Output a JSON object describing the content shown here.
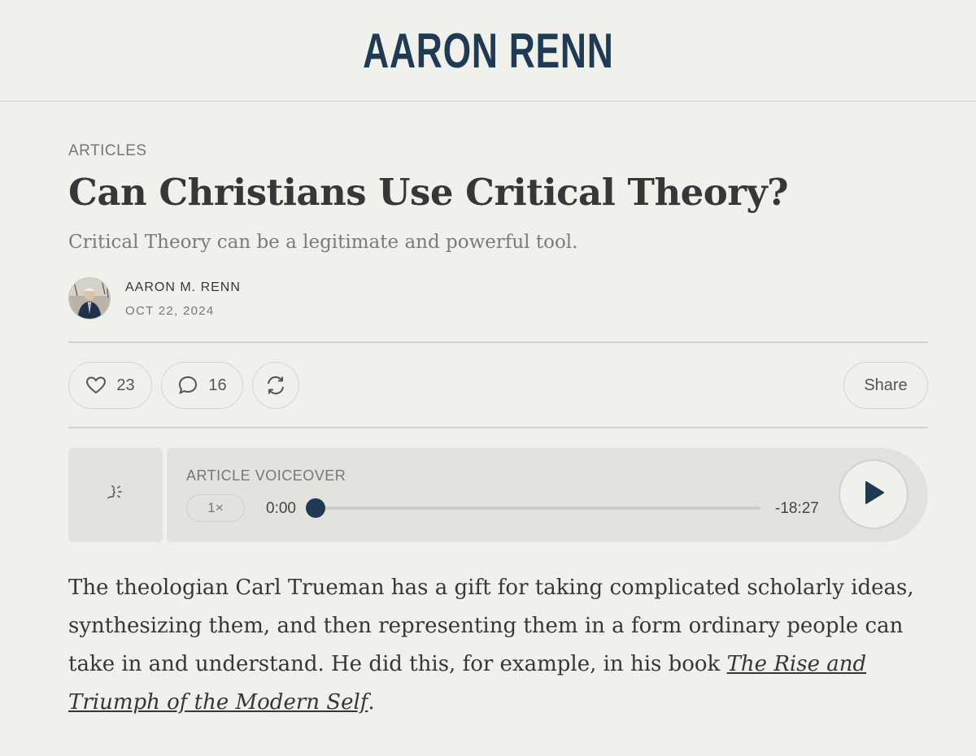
{
  "site": {
    "logo": "AARON RENN"
  },
  "post": {
    "category": "ARTICLES",
    "title": "Can Christians Use Critical Theory?",
    "subtitle": "Critical Theory can be a legitimate and powerful tool.",
    "author": "AARON M. RENN",
    "date": "OCT 22, 2024"
  },
  "actions": {
    "likes": "23",
    "comments": "16",
    "share_label": "Share",
    "icons": [
      "heart-icon",
      "comment-bubble-icon",
      "restack-icon"
    ]
  },
  "voiceover": {
    "label": "ARTICLE VOICEOVER",
    "speed": "1×",
    "current_time": "0:00",
    "remaining_time": "-18:27",
    "progress": 0,
    "icons": [
      "speaker-icon",
      "play-icon"
    ]
  },
  "body": {
    "paragraph1_text": "The theologian Carl Trueman has a gift for taking complicated scholarly ideas, synthesizing them, and then representing them in a form ordinary people can take in and understand. He did this, for example, in his book ",
    "paragraph1_link": "The Rise and Triumph of the Modern Self",
    "paragraph1_end": "."
  },
  "colors": {
    "background": "#f1f1ec",
    "brand": "#1e3a55",
    "text": "#363737",
    "muted": "#777777"
  }
}
